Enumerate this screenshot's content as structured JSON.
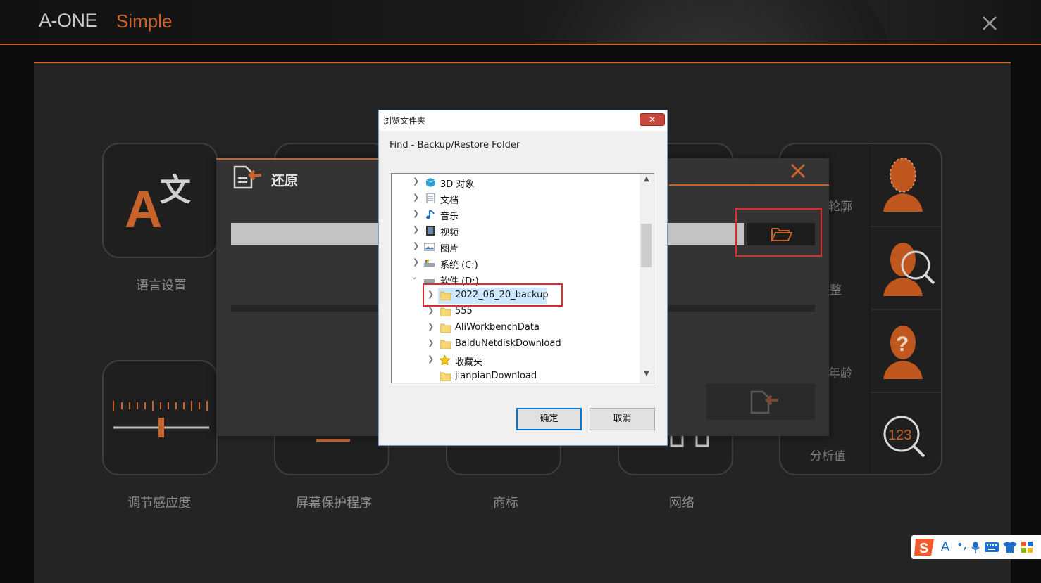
{
  "app": {
    "brand_main": "A-ONE",
    "brand_sub": "Simple"
  },
  "colors": {
    "accent": "#c8632c",
    "highlight": "#e32b2b",
    "dialog_primary_border": "#0078d7"
  },
  "tiles": [
    {
      "label": "语言设置",
      "icon": "language-icon"
    },
    {
      "label": "调节感应度",
      "icon": "sensitivity-slider-icon"
    },
    {
      "label": "屏幕保护程序",
      "icon": "screensaver-icon"
    },
    {
      "label": "商标",
      "icon": "logo-icon"
    },
    {
      "label": "网络",
      "icon": "network-icon"
    }
  ],
  "side_items": [
    {
      "label": "轮廓",
      "icon": "face-contour-icon"
    },
    {
      "label": "整",
      "icon": "face-search-icon"
    },
    {
      "label": "年龄",
      "icon": "face-question-icon"
    },
    {
      "label": "分析值",
      "icon": "analysis-123-icon"
    }
  ],
  "restore_panel": {
    "title": "还原",
    "path_value": "",
    "icon": "restore-icon"
  },
  "dialog": {
    "title": "浏览文件夹",
    "close_label": "✕",
    "description": "Find - Backup/Restore Folder",
    "tree": [
      {
        "label": "3D 对象",
        "icon": "3d-objects-icon",
        "expanded": false
      },
      {
        "label": "文档",
        "icon": "documents-icon",
        "expanded": false
      },
      {
        "label": "音乐",
        "icon": "music-icon",
        "expanded": false
      },
      {
        "label": "视频",
        "icon": "video-icon",
        "expanded": false
      },
      {
        "label": "图片",
        "icon": "pictures-icon",
        "expanded": false
      },
      {
        "label": "系统 (C:)",
        "icon": "drive-c-icon",
        "expanded": false
      },
      {
        "label": "软件 (D:)",
        "icon": "drive-d-icon",
        "expanded": true
      },
      {
        "label": "2022_06_20_backup",
        "icon": "folder-icon",
        "selected": true
      },
      {
        "label": "555",
        "icon": "folder-icon"
      },
      {
        "label": "AliWorkbenchData",
        "icon": "folder-icon"
      },
      {
        "label": "BaiduNetdiskDownload",
        "icon": "folder-icon"
      },
      {
        "label": "收藏夹",
        "icon": "favorites-icon"
      },
      {
        "label": "jianpianDownload",
        "icon": "folder-icon"
      }
    ],
    "ok_label": "确定",
    "cancel_label": "取消"
  },
  "ime": {
    "mode_text": "A"
  }
}
